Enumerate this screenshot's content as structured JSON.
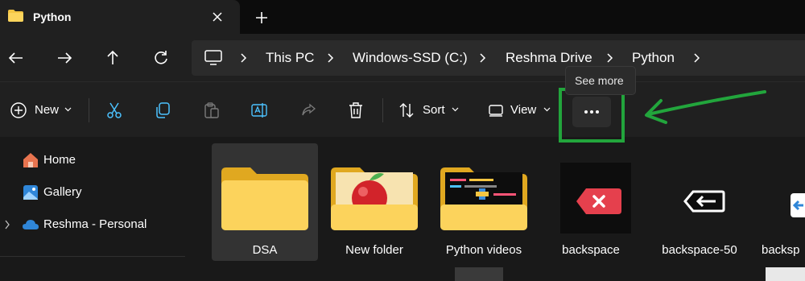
{
  "tab": {
    "title": "Python"
  },
  "breadcrumb": [
    "This PC",
    "Windows-SSD (C:)",
    "Reshma Drive",
    "Python"
  ],
  "commands": {
    "new_label": "New",
    "sort_label": "Sort",
    "view_label": "View",
    "more_label": "•••"
  },
  "tooltip": {
    "text": "See more"
  },
  "sidebar": {
    "items": [
      {
        "label": "Home",
        "icon": "home-icon"
      },
      {
        "label": "Gallery",
        "icon": "gallery-icon"
      },
      {
        "label": "Reshma - Personal",
        "icon": "onedrive-icon"
      }
    ]
  },
  "files": [
    {
      "name": "DSA",
      "type": "folder",
      "selected": true
    },
    {
      "name": "New folder",
      "type": "folder-apple"
    },
    {
      "name": "Python videos",
      "type": "folder-video"
    },
    {
      "name": "backspace",
      "type": "image"
    },
    {
      "name": "backspace-50",
      "type": "image"
    },
    {
      "name": "backsp",
      "type": "image"
    }
  ],
  "colors": {
    "highlight": "#22a53c",
    "arrow": "#22a53c",
    "folder": "#f4c542",
    "accent": "#4cc2ff",
    "backspace_red": "#e5404d"
  }
}
